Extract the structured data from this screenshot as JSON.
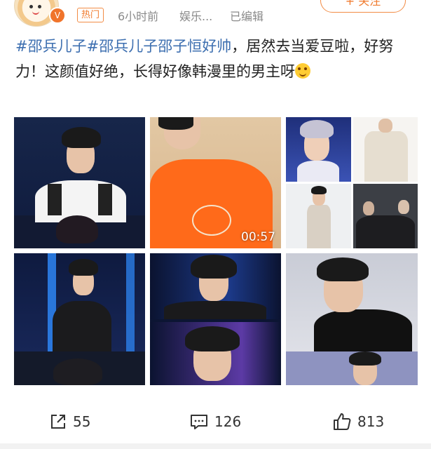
{
  "header": {
    "hot_label": "热门",
    "time": "6小时前",
    "source": "娱乐...",
    "edited": "已编辑",
    "follow_label": "+ 关注"
  },
  "post": {
    "hashtag1": "#邵兵儿子",
    "hashtag2": "#邵兵儿子邵子恒好帅",
    "text": "，居然去当爱豆啦，好努力！这颜值好绝，长得好像韩漫里的男主呀"
  },
  "media": {
    "video_duration": "00:57"
  },
  "actions": {
    "repost_count": "55",
    "comment_count": "126",
    "like_count": "813"
  },
  "colors": {
    "accent": "#f07c30",
    "hashtag": "#3d6fb0"
  }
}
